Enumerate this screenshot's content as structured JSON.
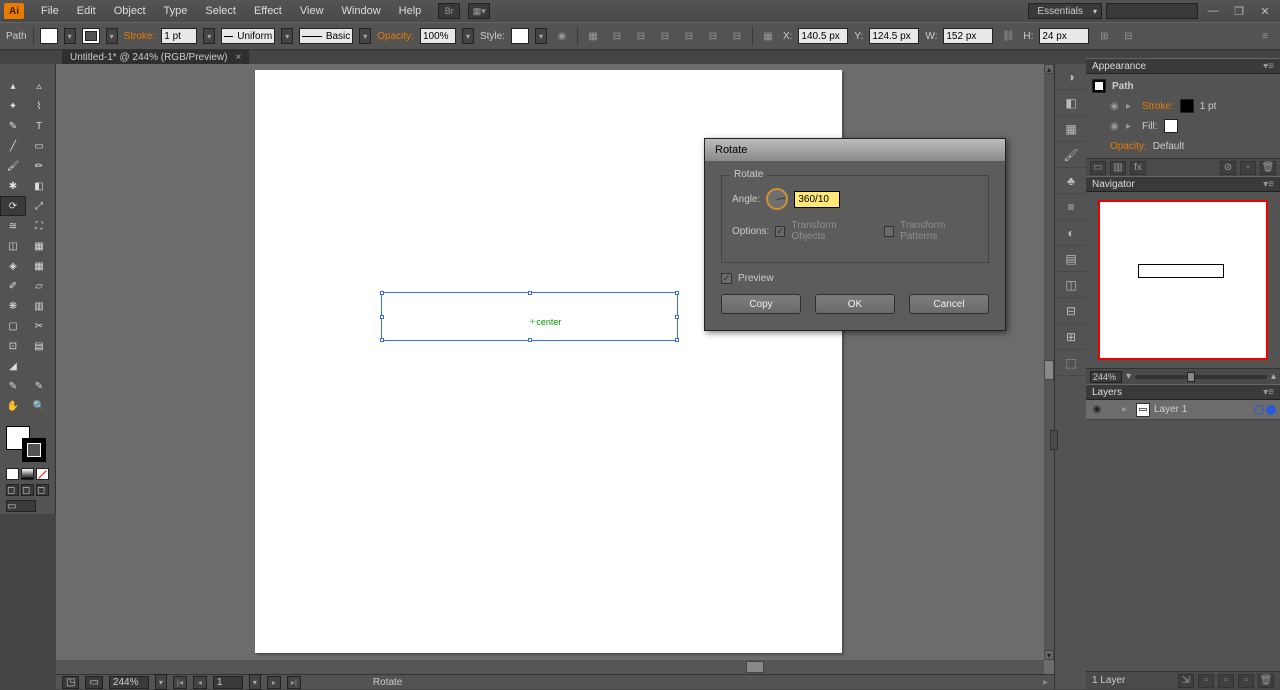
{
  "menu": {
    "file": "File",
    "edit": "Edit",
    "object": "Object",
    "type": "Type",
    "select": "Select",
    "effect": "Effect",
    "view": "View",
    "window": "Window",
    "help": "Help"
  },
  "app": {
    "icon": "Ai",
    "workspace": "Essentials",
    "br": "Br"
  },
  "ctrl": {
    "sel_label": "Path",
    "stroke_label": "Stroke:",
    "stroke_weight": "1 pt",
    "profile_label": "Uniform",
    "brush_label": "Basic",
    "opacity_label": "Opacity:",
    "opacity_value": "100%",
    "style_label": "Style:",
    "x_label": "X:",
    "x_value": "140.5 px",
    "y_label": "Y:",
    "y_value": "124.5 px",
    "w_label": "W:",
    "w_value": "152 px",
    "h_label": "H:",
    "h_value": "24 px"
  },
  "tab": {
    "title": "Untitled-1* @ 244% (RGB/Preview)",
    "close": "×"
  },
  "canvas": {
    "center_label": "center"
  },
  "navigator": {
    "title": "Navigator",
    "zoom": "244%"
  },
  "appearance": {
    "title": "Appearance",
    "obj": "Path",
    "stroke_label": "Stroke:",
    "stroke_val": "1 pt",
    "fill_label": "Fill:",
    "opacity_label": "Opacity:",
    "opacity_val": "Default"
  },
  "layers": {
    "title": "Layers",
    "layer1": "Layer 1",
    "footer": "1 Layer"
  },
  "status": {
    "zoom": "244%",
    "page": "1",
    "tool": "Rotate"
  },
  "dialog": {
    "title": "Rotate",
    "group_label": "Rotate",
    "angle_label": "Angle:",
    "angle_value": "360/10",
    "options_label": "Options:",
    "opt_objects": "Transform Objects",
    "opt_patterns": "Transform Patterns",
    "preview": "Preview",
    "copy": "Copy",
    "ok": "OK",
    "cancel": "Cancel"
  }
}
